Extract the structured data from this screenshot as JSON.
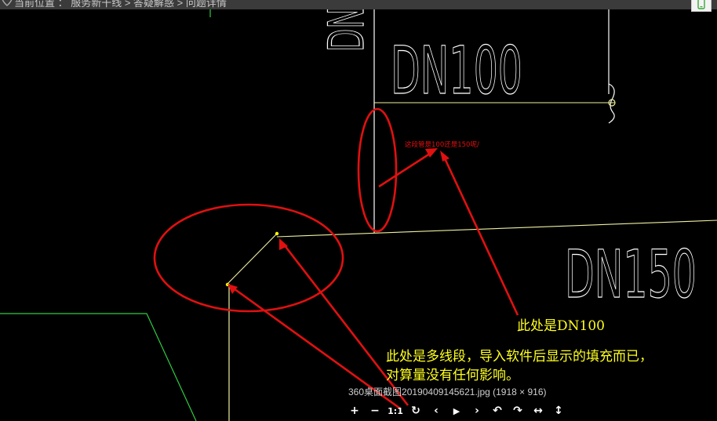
{
  "breadcrumb": {
    "text": "当前位置 ： 服务新干线 > 答疑解惑 > 问题详情"
  },
  "drawing": {
    "label_dn_vertical": "DN",
    "label_dn100": "DN100",
    "label_dn150": "DN150",
    "red_question": "这段管是100还是150呢/"
  },
  "annotations": {
    "note1": "此处是DN100",
    "note2": "此处是多线段，导入软件后显示的填充而已，",
    "note3": "对算量没有任何影响。"
  },
  "viewer": {
    "caption": "360桌面截图20190409145621.jpg (1918 × 916)",
    "toolbar": [
      {
        "name": "zoom-in-button",
        "glyph": "+"
      },
      {
        "name": "zoom-out-button",
        "glyph": "−"
      },
      {
        "name": "actual-size-button",
        "glyph": "1:1"
      },
      {
        "name": "rotate-button",
        "glyph": "↻"
      },
      {
        "name": "previous-button",
        "glyph": "‹"
      },
      {
        "name": "play-button",
        "glyph": "▶"
      },
      {
        "name": "next-button",
        "glyph": "›"
      },
      {
        "name": "rotate-left-button",
        "glyph": "↶"
      },
      {
        "name": "rotate-right-button",
        "glyph": "↷"
      },
      {
        "name": "fit-width-button",
        "glyph": "↔"
      },
      {
        "name": "fit-height-button",
        "glyph": "↕"
      }
    ]
  },
  "colors": {
    "cad_background": "#000000",
    "cad_white_line": "#ffffff",
    "cad_yellow_line": "#f0f0a0",
    "cad_green_line": "#2ecc40",
    "annotation_red": "#e11010",
    "annotation_text_yellow": "#ffff1e"
  }
}
